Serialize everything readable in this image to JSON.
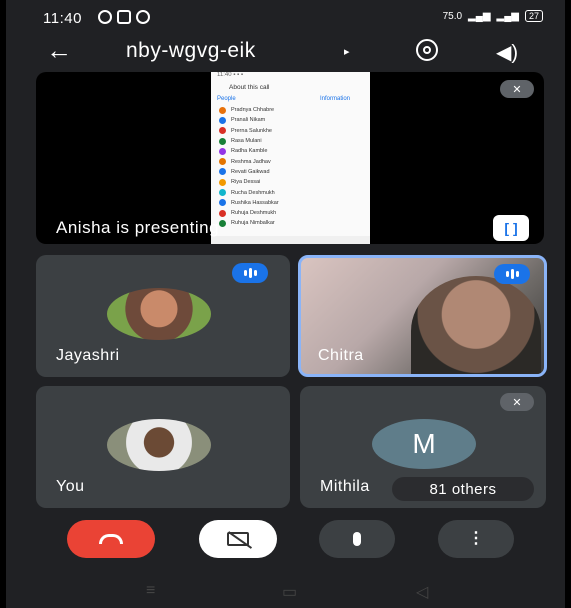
{
  "status_bar": {
    "time": "11:40",
    "speed": "75.0",
    "battery": "27"
  },
  "header": {
    "meeting_code": "nby-wgvg-eik",
    "dropdown_arrow": "▸",
    "back_icon": "arrow-left-icon",
    "camera_switch_icon": "camera-switch-icon",
    "audio_icon": "speaker-icon"
  },
  "presentation": {
    "label": "Anisha is presenting",
    "screen": {
      "title": "About this call",
      "col1": "People",
      "col2": "Information",
      "participants": [
        "Pradnya Chhabre",
        "Pranali Nikam",
        "Prerna Salunkhe",
        "Rasa Mulani",
        "Radha Kamble",
        "Reshma Jadhav",
        "Revati Gaikwad",
        "Riya Dessai",
        "Rucha Deshmukh",
        "Rushika Hassabkar",
        "Ruhuja Deshmukh",
        "Ruhuja Nimbalkar"
      ]
    }
  },
  "tiles": [
    {
      "name": "Jayashri"
    },
    {
      "name": "Chitra"
    },
    {
      "name": "You"
    },
    {
      "name": "Mithila",
      "avatar_letter": "M",
      "others": "81 others"
    }
  ],
  "controls": {
    "end_call": "end-call-icon",
    "camera_off": "camera-off-icon",
    "mic": "mic-icon",
    "more": "more-vertical-icon"
  },
  "colors": {
    "end_call": "#ea4335",
    "speaking": "#1a73e8"
  }
}
